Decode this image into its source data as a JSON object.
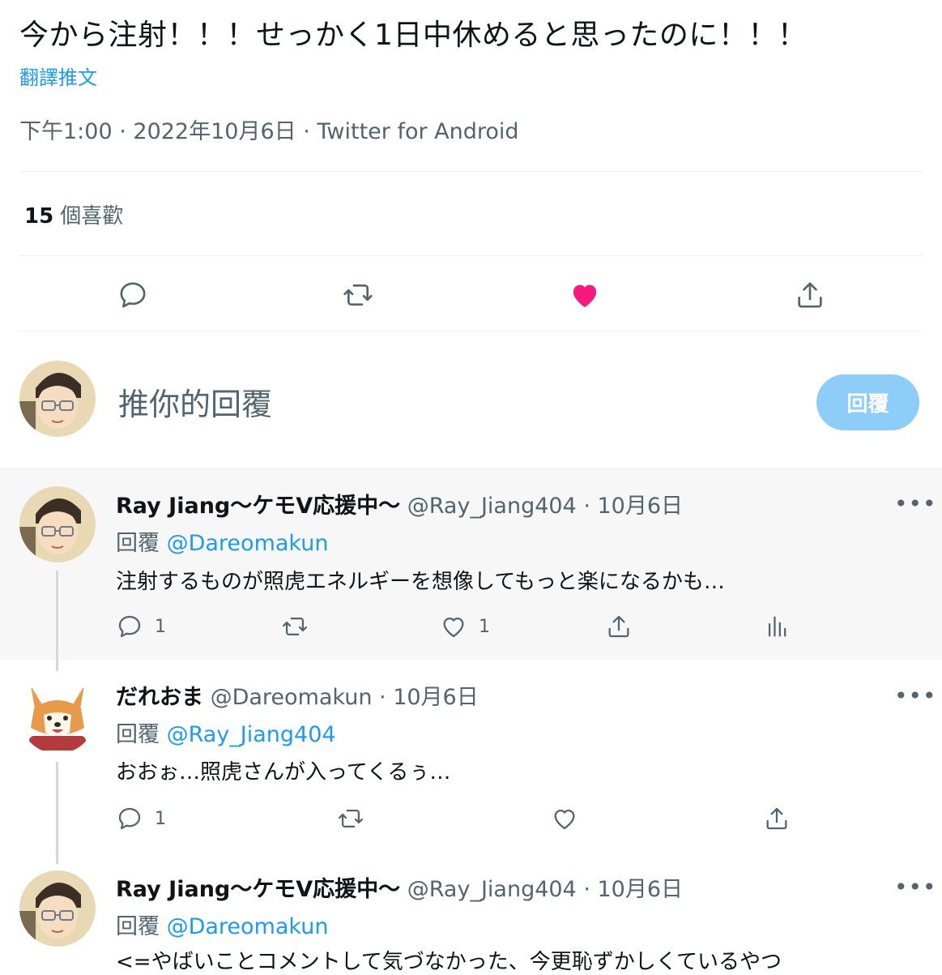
{
  "tweet": {
    "text": "今から注射！！！せっかく1日中休めると思ったのに！！！",
    "translate_label": "翻譯推文",
    "time": "下午1:00",
    "date": "2022年10月6日",
    "source": "Twitter for Android",
    "likes_count": "15",
    "likes_label": "個喜歡",
    "separator": " · "
  },
  "reply_box": {
    "placeholder": "推你的回覆",
    "button_label": "回覆"
  },
  "colors": {
    "accent": "#1d9bf0",
    "like": "#f91880",
    "text": "#0f1419",
    "muted": "#536471"
  },
  "replies": [
    {
      "name": "Ray Jiang〜ケモV応援中〜",
      "handle": "@Ray_Jiang404",
      "date": "10月6日",
      "replying_prefix": "回覆",
      "replying_to": "@Dareomakun",
      "text": "注射するものが照虎エネルギーを想像してもっと楽になるかも…",
      "reply_count": "1",
      "like_count": "1",
      "more": "•••"
    },
    {
      "name": "だれおま",
      "handle": "@Dareomakun",
      "date": "10月6日",
      "replying_prefix": "回覆",
      "replying_to": "@Ray_Jiang404",
      "text": "おおぉ…照虎さんが入ってくるぅ…",
      "reply_count": "1",
      "more": "•••"
    },
    {
      "name": "Ray Jiang〜ケモV応援中〜",
      "handle": "@Ray_Jiang404",
      "date": "10月6日",
      "replying_prefix": "回覆",
      "replying_to": "@Dareomakun",
      "text": "<=やばいことコメントして気づなかった、今更恥ずかしくているやつ",
      "more": "•••"
    }
  ]
}
